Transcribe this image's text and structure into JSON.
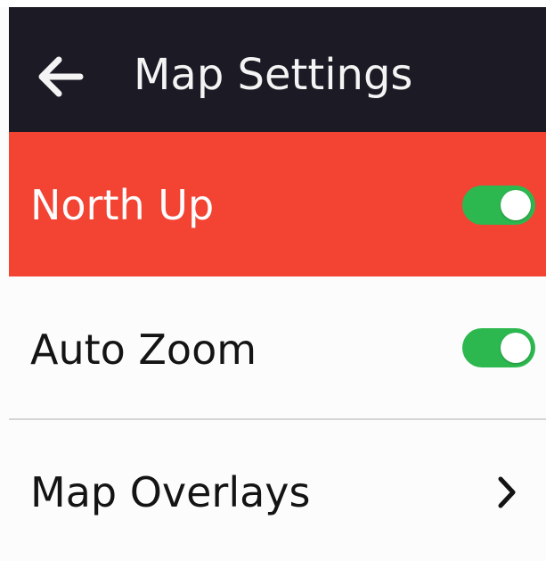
{
  "header": {
    "title": "Map Settings",
    "back_icon": "arrow-left-icon",
    "background": "#1b1a25"
  },
  "settings": [
    {
      "label": "North Up",
      "control": "toggle",
      "enabled": true,
      "highlighted": true,
      "background": "#f24333"
    },
    {
      "label": "Auto Zoom",
      "control": "toggle",
      "enabled": true,
      "highlighted": false
    },
    {
      "label": "Map Overlays",
      "control": "chevron",
      "icon": "chevron-right-icon"
    }
  ],
  "colors": {
    "toggle_on": "#2db84f",
    "highlight": "#f24333",
    "header": "#1b1a25"
  }
}
